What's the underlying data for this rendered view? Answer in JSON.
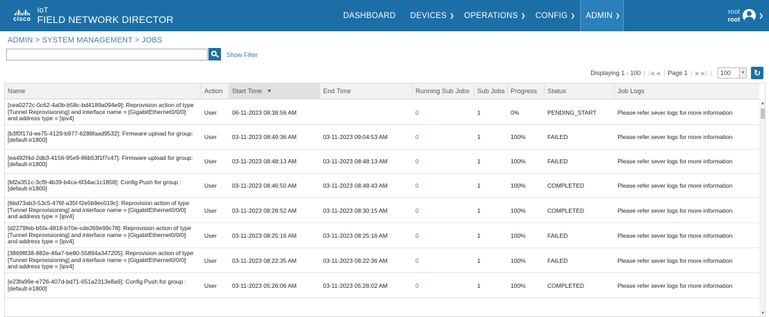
{
  "header": {
    "logo_word": "cisco",
    "product_top": "IoT",
    "product_name": "FIELD NETWORK DIRECTOR",
    "nav": [
      {
        "label": "DASHBOARD",
        "has_menu": false
      },
      {
        "label": "DEVICES",
        "has_menu": true
      },
      {
        "label": "OPERATIONS",
        "has_menu": true
      },
      {
        "label": "CONFIG",
        "has_menu": true
      },
      {
        "label": "ADMIN",
        "has_menu": true,
        "active": true
      }
    ],
    "user_name": "root",
    "user_sub": "root",
    "brand_color": "#1c6fa6"
  },
  "breadcrumb": "ADMIN > SYSTEM MANAGEMENT > JOBS",
  "search": {
    "value": "",
    "placeholder": "",
    "show_filter": "Show Filter"
  },
  "pager": {
    "displaying": "Displaying 1 - 100",
    "page_label": "Page 1",
    "page_size": "100"
  },
  "table": {
    "columns": [
      "Name",
      "Action",
      "Start Time",
      "End Time",
      "Running Sub Jobs",
      "Sub Jobs",
      "Progress",
      "Status",
      "Job Logs"
    ],
    "sort_column": "Start Time",
    "rows": [
      {
        "name": "[cea0272c-0c62-4a0b-b58c-bd4189a094e9]: Reprovision action of type [Tunnel Reprovisioning] and interface name = [GigabitEthernet0/0/0] and address type = [ipv4]",
        "action": "User",
        "start": "06-11-2023 08:38:56 AM",
        "end": "",
        "running": "0",
        "sub": "1",
        "progress": "0%",
        "status": "PENDING_START",
        "logs": "Please refer sever logs for more information"
      },
      {
        "name": "[b3f0f17d-ee75-4129-b977-6288faad9532]: Firmware upload for group: [default-ir1800]",
        "action": "User",
        "start": "03-11-2023 08:49:36 AM",
        "end": "03-11-2023 09:04:53 AM",
        "running": "0",
        "sub": "1",
        "progress": "100%",
        "status": "FAILED",
        "logs": "Please refer sever logs for more information"
      },
      {
        "name": "[ea492f4d-2db3-4156-95e9-86b53f1f7c47]: Firmware upload for group: [default-ir1800]",
        "action": "User",
        "start": "03-11-2023 08:48:13 AM",
        "end": "03-11-2023 08:48:13 AM",
        "running": "0",
        "sub": "1",
        "progress": "100%",
        "status": "FAILED",
        "logs": "Please refer sever logs for more information"
      },
      {
        "name": "[bf2a351c-3cf9-4b39-b4ca-6f34ac1c1858]: Config Push for group : [default-ir1800]",
        "action": "User",
        "start": "03-11-2023 08:46:50 AM",
        "end": "03-11-2023 08:48:43 AM",
        "running": "0",
        "sub": "1",
        "progress": "100%",
        "status": "COMPLETED",
        "logs": "Please refer sever logs for more information"
      },
      {
        "name": "[6bd73ab3-53c5-476f-a35f-f2e5b9ec019c]: Reprovision action of type [Tunnel Reprovisioning] and interface name = [GigabitEthernet0/0/0] and address type = [ipv4]",
        "action": "User",
        "start": "03-11-2023 08:28:52 AM",
        "end": "03-11-2023 08:30:15 AM",
        "running": "0",
        "sub": "1",
        "progress": "100%",
        "status": "COMPLETED",
        "logs": "Please refer sever logs for more information"
      },
      {
        "name": "[d2279feb-b5fa-4818-b70e-cde269e99c78]: Reprovision action of type [Tunnel Reprovisioning] and interface name = [GigabitEthernet0/0/0] and address type = [ipv4]",
        "action": "User",
        "start": "03-11-2023 08:25:16 AM",
        "end": "03-11-2023 08:25:16 AM",
        "running": "0",
        "sub": "1",
        "progress": "100%",
        "status": "FAILED",
        "logs": "Please refer sever logs for more information"
      },
      {
        "name": "[3869f838-882e-46a7-be80-55894a347205]: Reprovision action of type [Tunnel Reprovisioning] and interface name = [GigabitEthernet0/0/0] and address type = [ipv4]",
        "action": "User",
        "start": "03-11-2023 08:22:35 AM",
        "end": "03-11-2023 08:22:36 AM",
        "running": "0",
        "sub": "1",
        "progress": "100%",
        "status": "FAILED",
        "logs": "Please refer sever logs for more information"
      },
      {
        "name": "[e23fa99e-e726-407d-bd71-651a2313e8a6]: Config Push for group : [default-ir1800]",
        "action": "User",
        "start": "03-11-2023 05:26:06 AM",
        "end": "03-11-2023 05:28:02 AM",
        "running": "0",
        "sub": "1",
        "progress": "100%",
        "status": "COMPLETED",
        "logs": "Please refer sever logs for more information"
      }
    ]
  }
}
